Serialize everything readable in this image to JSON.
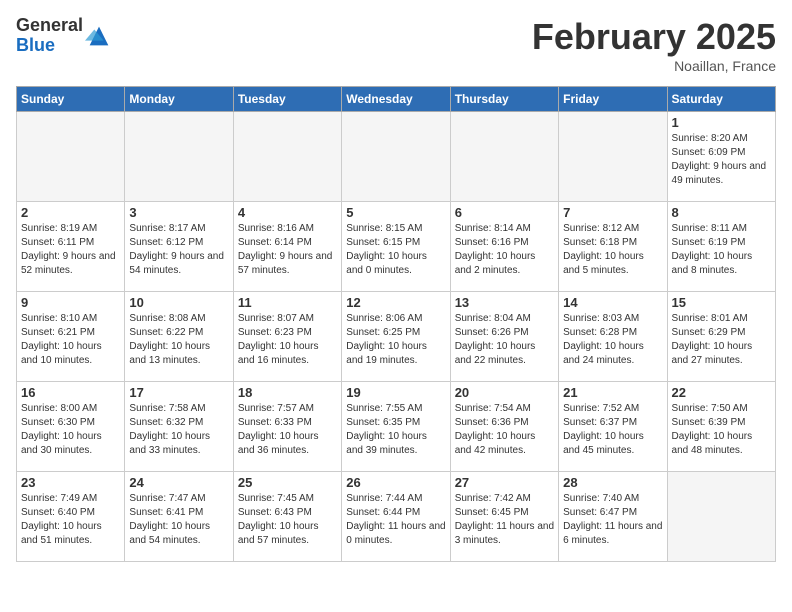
{
  "header": {
    "logo_general": "General",
    "logo_blue": "Blue",
    "month_title": "February 2025",
    "location": "Noaillan, France"
  },
  "days_of_week": [
    "Sunday",
    "Monday",
    "Tuesday",
    "Wednesday",
    "Thursday",
    "Friday",
    "Saturday"
  ],
  "weeks": [
    [
      {
        "day": "",
        "info": ""
      },
      {
        "day": "",
        "info": ""
      },
      {
        "day": "",
        "info": ""
      },
      {
        "day": "",
        "info": ""
      },
      {
        "day": "",
        "info": ""
      },
      {
        "day": "",
        "info": ""
      },
      {
        "day": "1",
        "info": "Sunrise: 8:20 AM\nSunset: 6:09 PM\nDaylight: 9 hours and 49 minutes."
      }
    ],
    [
      {
        "day": "2",
        "info": "Sunrise: 8:19 AM\nSunset: 6:11 PM\nDaylight: 9 hours and 52 minutes."
      },
      {
        "day": "3",
        "info": "Sunrise: 8:17 AM\nSunset: 6:12 PM\nDaylight: 9 hours and 54 minutes."
      },
      {
        "day": "4",
        "info": "Sunrise: 8:16 AM\nSunset: 6:14 PM\nDaylight: 9 hours and 57 minutes."
      },
      {
        "day": "5",
        "info": "Sunrise: 8:15 AM\nSunset: 6:15 PM\nDaylight: 10 hours and 0 minutes."
      },
      {
        "day": "6",
        "info": "Sunrise: 8:14 AM\nSunset: 6:16 PM\nDaylight: 10 hours and 2 minutes."
      },
      {
        "day": "7",
        "info": "Sunrise: 8:12 AM\nSunset: 6:18 PM\nDaylight: 10 hours and 5 minutes."
      },
      {
        "day": "8",
        "info": "Sunrise: 8:11 AM\nSunset: 6:19 PM\nDaylight: 10 hours and 8 minutes."
      }
    ],
    [
      {
        "day": "9",
        "info": "Sunrise: 8:10 AM\nSunset: 6:21 PM\nDaylight: 10 hours and 10 minutes."
      },
      {
        "day": "10",
        "info": "Sunrise: 8:08 AM\nSunset: 6:22 PM\nDaylight: 10 hours and 13 minutes."
      },
      {
        "day": "11",
        "info": "Sunrise: 8:07 AM\nSunset: 6:23 PM\nDaylight: 10 hours and 16 minutes."
      },
      {
        "day": "12",
        "info": "Sunrise: 8:06 AM\nSunset: 6:25 PM\nDaylight: 10 hours and 19 minutes."
      },
      {
        "day": "13",
        "info": "Sunrise: 8:04 AM\nSunset: 6:26 PM\nDaylight: 10 hours and 22 minutes."
      },
      {
        "day": "14",
        "info": "Sunrise: 8:03 AM\nSunset: 6:28 PM\nDaylight: 10 hours and 24 minutes."
      },
      {
        "day": "15",
        "info": "Sunrise: 8:01 AM\nSunset: 6:29 PM\nDaylight: 10 hours and 27 minutes."
      }
    ],
    [
      {
        "day": "16",
        "info": "Sunrise: 8:00 AM\nSunset: 6:30 PM\nDaylight: 10 hours and 30 minutes."
      },
      {
        "day": "17",
        "info": "Sunrise: 7:58 AM\nSunset: 6:32 PM\nDaylight: 10 hours and 33 minutes."
      },
      {
        "day": "18",
        "info": "Sunrise: 7:57 AM\nSunset: 6:33 PM\nDaylight: 10 hours and 36 minutes."
      },
      {
        "day": "19",
        "info": "Sunrise: 7:55 AM\nSunset: 6:35 PM\nDaylight: 10 hours and 39 minutes."
      },
      {
        "day": "20",
        "info": "Sunrise: 7:54 AM\nSunset: 6:36 PM\nDaylight: 10 hours and 42 minutes."
      },
      {
        "day": "21",
        "info": "Sunrise: 7:52 AM\nSunset: 6:37 PM\nDaylight: 10 hours and 45 minutes."
      },
      {
        "day": "22",
        "info": "Sunrise: 7:50 AM\nSunset: 6:39 PM\nDaylight: 10 hours and 48 minutes."
      }
    ],
    [
      {
        "day": "23",
        "info": "Sunrise: 7:49 AM\nSunset: 6:40 PM\nDaylight: 10 hours and 51 minutes."
      },
      {
        "day": "24",
        "info": "Sunrise: 7:47 AM\nSunset: 6:41 PM\nDaylight: 10 hours and 54 minutes."
      },
      {
        "day": "25",
        "info": "Sunrise: 7:45 AM\nSunset: 6:43 PM\nDaylight: 10 hours and 57 minutes."
      },
      {
        "day": "26",
        "info": "Sunrise: 7:44 AM\nSunset: 6:44 PM\nDaylight: 11 hours and 0 minutes."
      },
      {
        "day": "27",
        "info": "Sunrise: 7:42 AM\nSunset: 6:45 PM\nDaylight: 11 hours and 3 minutes."
      },
      {
        "day": "28",
        "info": "Sunrise: 7:40 AM\nSunset: 6:47 PM\nDaylight: 11 hours and 6 minutes."
      },
      {
        "day": "",
        "info": ""
      }
    ]
  ]
}
